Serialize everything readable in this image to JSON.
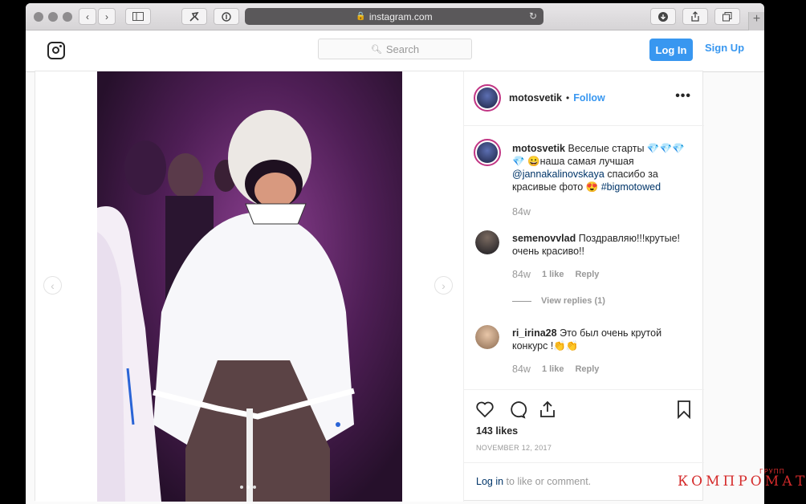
{
  "browser": {
    "url": "instagram.com",
    "lock_icon": "lock-icon"
  },
  "header": {
    "search_placeholder": "Search",
    "login_label": "Log In",
    "signup_label": "Sign Up"
  },
  "post": {
    "author": "motosvetik",
    "follow_label": "Follow",
    "separator": "•",
    "caption": {
      "username": "motosvetik",
      "text_part1": "Веселые старты 💎💎💎💎 😀наша самая лучшая",
      "mention": "@jannakalinovskaya",
      "text_part2": "спасибо за красивые фото 😍",
      "hashtag": "#bigmotowed",
      "age": "84w"
    },
    "comments": [
      {
        "username": "semenovvlad",
        "text": "Поздравляю!!!крутые! очень красиво!!",
        "age": "84w",
        "likes": "1 like",
        "reply": "Reply"
      },
      {
        "username": "ri_irina28",
        "text": "Это был очень крутой конкурс !👏👏",
        "age": "84w",
        "likes": "1 like",
        "reply": "Reply"
      }
    ],
    "view_replies": "View replies (1)",
    "likes_count": "143 likes",
    "date": "NOVEMBER 12, 2017",
    "login_prompt_link": "Log in",
    "login_prompt_text": "to like or comment."
  },
  "watermark": {
    "main": "КОМПРОМАТ",
    "small": "ГРУПП"
  },
  "colors": {
    "accent": "#3897f0",
    "link": "#003569",
    "watermark": "#d52b2b"
  }
}
